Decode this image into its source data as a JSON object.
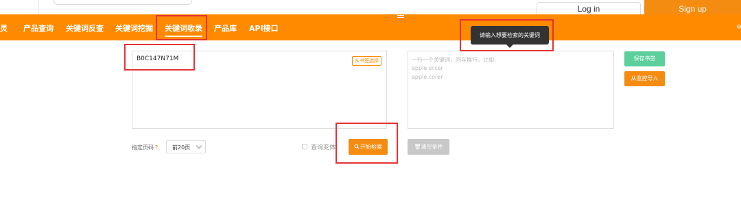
{
  "header": {
    "login_label": "Log in",
    "signup_label": "Sign up"
  },
  "nav": {
    "logo_fragment": "灵",
    "items": [
      {
        "label": "产品查询"
      },
      {
        "label": "关键词反查"
      },
      {
        "label": "关键词挖掘"
      },
      {
        "label": "关键词收录"
      },
      {
        "label": "产品库"
      },
      {
        "label": "API接口"
      }
    ],
    "active_index": 3
  },
  "tooltip": {
    "text": "请输入想要检索的关键词"
  },
  "asin_input": {
    "value": "B0C147N71M",
    "bookmark_button": "从书签选择"
  },
  "keyword_input": {
    "placeholder_lines": [
      "一行一个关键词，回车换行，比如:",
      "apple slicer",
      "apple corer"
    ]
  },
  "buttons": {
    "save_bookmark": "保存书签",
    "import_from_monitor": "从监控导入",
    "start_search": "开始检索",
    "clear_conditions": "清空条件"
  },
  "controls": {
    "page_label": "指定页码",
    "page_help": "?",
    "page_select_value": "前20页",
    "variant_label": "查询变体"
  },
  "colors": {
    "brand_orange": "#ff8a00",
    "save_green": "#5ccf9a",
    "annotation_red": "#e63232"
  }
}
